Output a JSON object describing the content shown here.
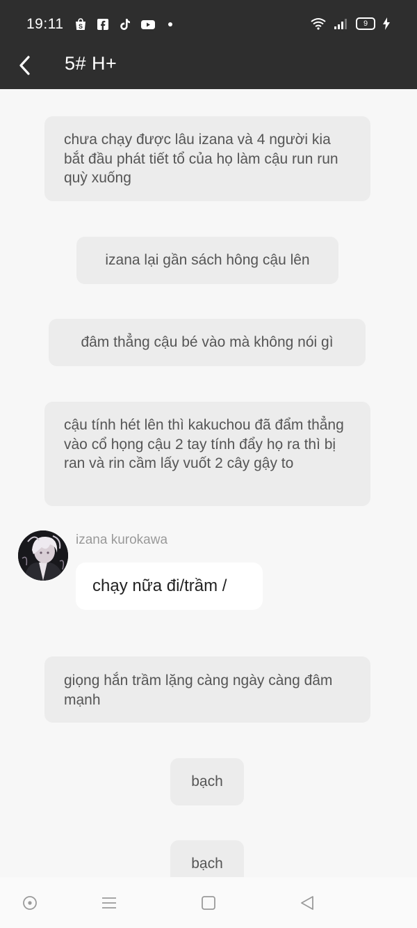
{
  "status_bar": {
    "time": "19:11",
    "app_icons": [
      "shopee-icon",
      "facebook-icon",
      "tiktok-icon",
      "youtube-icon",
      "notification-dot-icon"
    ],
    "battery_level": "9"
  },
  "header": {
    "back_icon": "chevron-left-icon",
    "title": "5# H+"
  },
  "messages": {
    "m1": "chưa chạy được lâu izana và 4 người kia bắt đầu phát tiết tổ của họ làm cậu run run quỳ xuống",
    "m2": "izana lại gần sách hông cậu lên",
    "m3": "đâm thẳng cậu bé vào mà không nói gì",
    "m4": "cậu tính hét lên thì kakuchou đã đẩm thẳng vào cổ họng cậu 2 tay tính đẩy họ ra thì bị ran và rin cầm lấy vuốt 2 cây gậy to",
    "sender_name": "izana kurokawa",
    "user_message": "chạy nữa đi/trầm /",
    "m5": "giọng hắn trầm lặng càng ngày càng đâm mạnh",
    "m6": "bạch",
    "m7": "bạch"
  },
  "colors": {
    "header_bg": "#2e2e2e",
    "chat_bg": "#f7f7f7",
    "narration_bg": "#ececec",
    "user_bubble_bg": "#ffffff",
    "sender_name": "#999999"
  },
  "nav_bar": {
    "icons": [
      "circle-dot-icon",
      "menu-icon",
      "square-icon",
      "back-triangle-icon"
    ]
  }
}
